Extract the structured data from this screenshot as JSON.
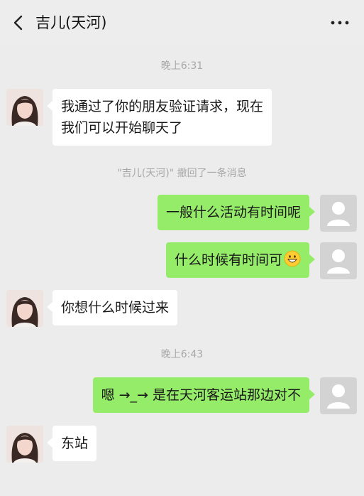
{
  "header": {
    "title": "吉儿(天河)"
  },
  "timestamps": [
    "晚上6:31",
    "晚上6:43"
  ],
  "recall_notice": "\"吉儿(天河)\" 撤回了一条消息",
  "messages": [
    {
      "side": "incoming",
      "lines": [
        "我通过了你的朋友验证请求，现在",
        "我们可以开始聊天了"
      ]
    },
    {
      "side": "outgoing",
      "text": "一般什么活动有时间呢"
    },
    {
      "side": "outgoing",
      "text": "什么时候有时间可",
      "emoji": "grinning-face-emoji"
    },
    {
      "side": "incoming",
      "text": "你想什么时候过来"
    },
    {
      "side": "outgoing",
      "text": "嗯 →_→ 是在天河客运站那边对不"
    },
    {
      "side": "incoming",
      "text": "东站"
    }
  ],
  "colors": {
    "background": "#ececec",
    "outgoing_bubble": "#95ec69",
    "incoming_bubble": "#ffffff",
    "system_text": "#a8a8a8"
  }
}
